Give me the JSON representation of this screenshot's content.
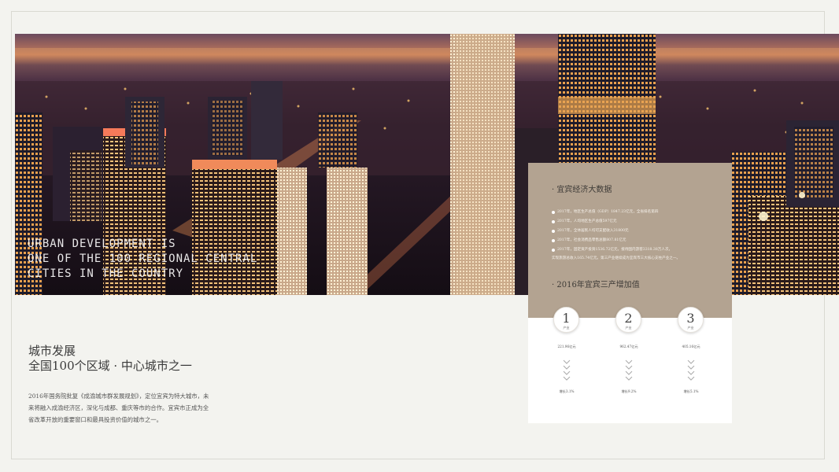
{
  "hero": {
    "caption_lines": [
      "URBAN DEVELOPMENT IS",
      "ONE OF THE 100 REGIONAL CENTRAL",
      "CITIES IN THE COUNTRY"
    ]
  },
  "left": {
    "title_line1": "城市发展",
    "title_line2": "全国100个区域 · 中心城市之一",
    "description": "2016年国务院批复《成渝城市群发展规划》，定位宜宾为特大城市，未来将融入成渝经济区，深化与成都、重庆等市的合作。宜宾市正成为全省改革开放的重要窗口和最具投资价值的城市之一。"
  },
  "panel": {
    "section1_title": "· 宜宾经济大数据",
    "stats": [
      "2017年，地区生产总值（GDP）1847.23亿元，全省排名第四",
      "2017年，人均地区生产总值597亿元",
      "2017年，全体居民人均可支配收入31800元",
      "2017年，社会消费品零售总额807.81亿元",
      "2017年，固定资产投资1536.72亿元，接待国内游客3318.38万人次，"
    ],
    "stats_extra": "实现旅游总收入165.74亿元。第三产业继续成为宜宾市三大核心支柱产业之一。",
    "section2_title": "· 2016年宜宾三产增加值",
    "industries": [
      {
        "num": "1",
        "label": "产业",
        "value": "221.96亿元",
        "growth": "增长3.1%"
      },
      {
        "num": "2",
        "label": "产业",
        "value": "962.47亿元",
        "growth": "增长9.2%"
      },
      {
        "num": "3",
        "label": "产业",
        "value": "405.16亿元",
        "growth": "增长5.1%"
      }
    ]
  },
  "colors": {
    "panel_accent": "#b3a391",
    "background": "#f3f3ef"
  }
}
